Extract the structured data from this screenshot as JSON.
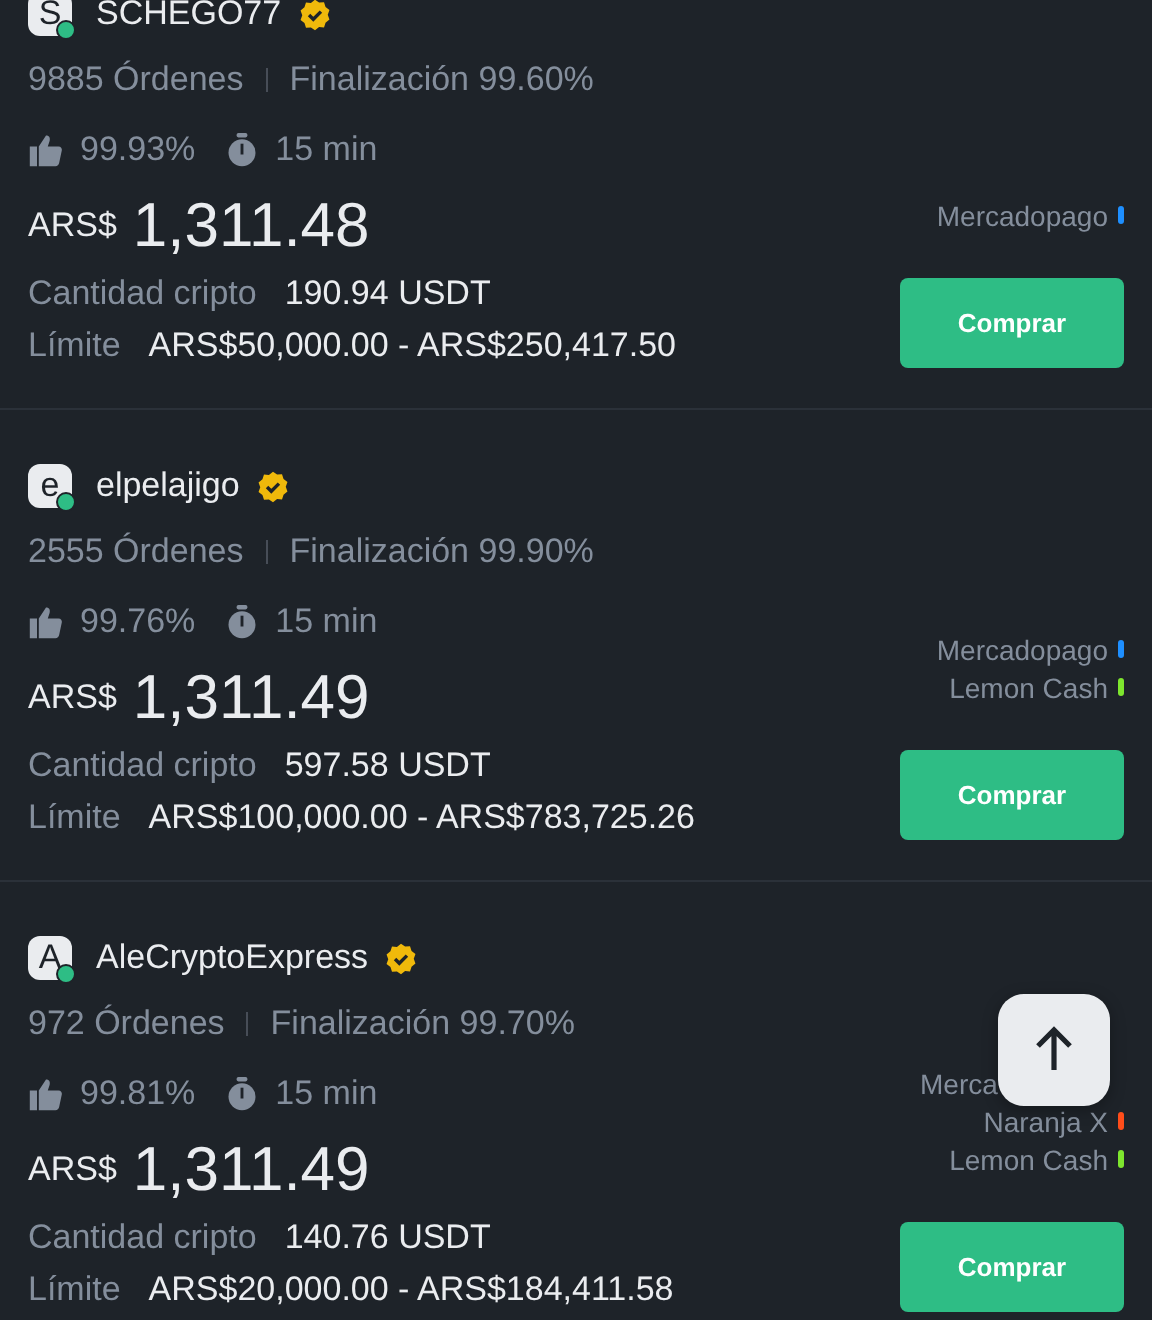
{
  "offers": [
    {
      "avatar": "S",
      "name": "SCHEGO77",
      "verified": true,
      "orders": "9885 Órdenes",
      "completion": "Finalización 99.60%",
      "likes": "99.93%",
      "time": "15 min",
      "currency": "ARS$",
      "price": "1,311.48",
      "amount_label": "Cantidad cripto",
      "amount": "190.94 USDT",
      "limit_label": "Límite",
      "limit": "ARS$50,000.00 - ARS$250,417.50",
      "payments": [
        {
          "name": "Mercadopago",
          "color": "#1e8fff"
        }
      ],
      "button": "Comprar"
    },
    {
      "avatar": "e",
      "name": "elpelajigo",
      "verified": true,
      "orders": "2555 Órdenes",
      "completion": "Finalización 99.90%",
      "likes": "99.76%",
      "time": "15 min",
      "currency": "ARS$",
      "price": "1,311.49",
      "amount_label": "Cantidad cripto",
      "amount": "597.58 USDT",
      "limit_label": "Límite",
      "limit": "ARS$100,000.00 - ARS$783,725.26",
      "payments": [
        {
          "name": "Mercadopago",
          "color": "#1e8fff"
        },
        {
          "name": "Lemon Cash",
          "color": "#7ee62e"
        }
      ],
      "button": "Comprar"
    },
    {
      "avatar": "A",
      "name": "AleCryptoExpress",
      "verified": true,
      "orders": "972 Órdenes",
      "completion": "Finalización 99.70%",
      "likes": "99.81%",
      "time": "15 min",
      "currency": "ARS$",
      "price": "1,311.49",
      "amount_label": "Cantidad cripto",
      "amount": "140.76 USDT",
      "limit_label": "Límite",
      "limit": "ARS$20,000.00 - ARS$184,411.58",
      "payments": [
        {
          "name": "Merca",
          "covered": true
        },
        {
          "name": "Naranja X",
          "color": "#ff4d1a"
        },
        {
          "name": "Lemon Cash",
          "color": "#7ee62e"
        }
      ],
      "button": "Comprar"
    }
  ],
  "scroll_top_button": true
}
